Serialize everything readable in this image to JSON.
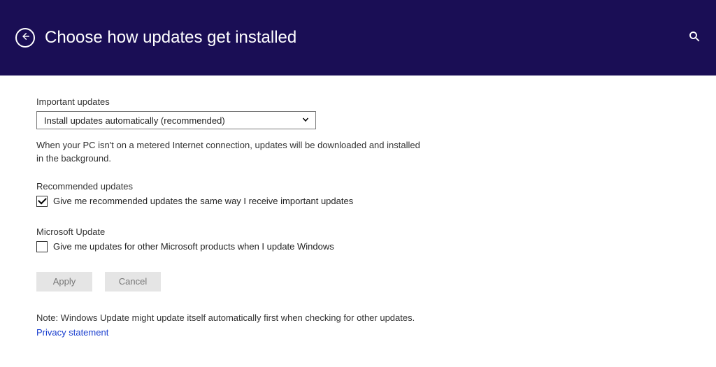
{
  "header": {
    "title": "Choose how updates get installed"
  },
  "sections": {
    "important": {
      "label": "Important updates",
      "dropdown_value": "Install updates automatically (recommended)",
      "description": "When your PC isn't on a metered Internet connection, updates will be downloaded and installed in the background."
    },
    "recommended": {
      "label": "Recommended updates",
      "checkbox_label": "Give me recommended updates the same way I receive important updates",
      "checked": true
    },
    "microsoft": {
      "label": "Microsoft Update",
      "checkbox_label": "Give me updates for other Microsoft products when I update Windows",
      "checked": false
    }
  },
  "buttons": {
    "apply": "Apply",
    "cancel": "Cancel"
  },
  "footer": {
    "note": "Note: Windows Update might update itself automatically first when checking for other updates.",
    "privacy": "Privacy statement"
  }
}
